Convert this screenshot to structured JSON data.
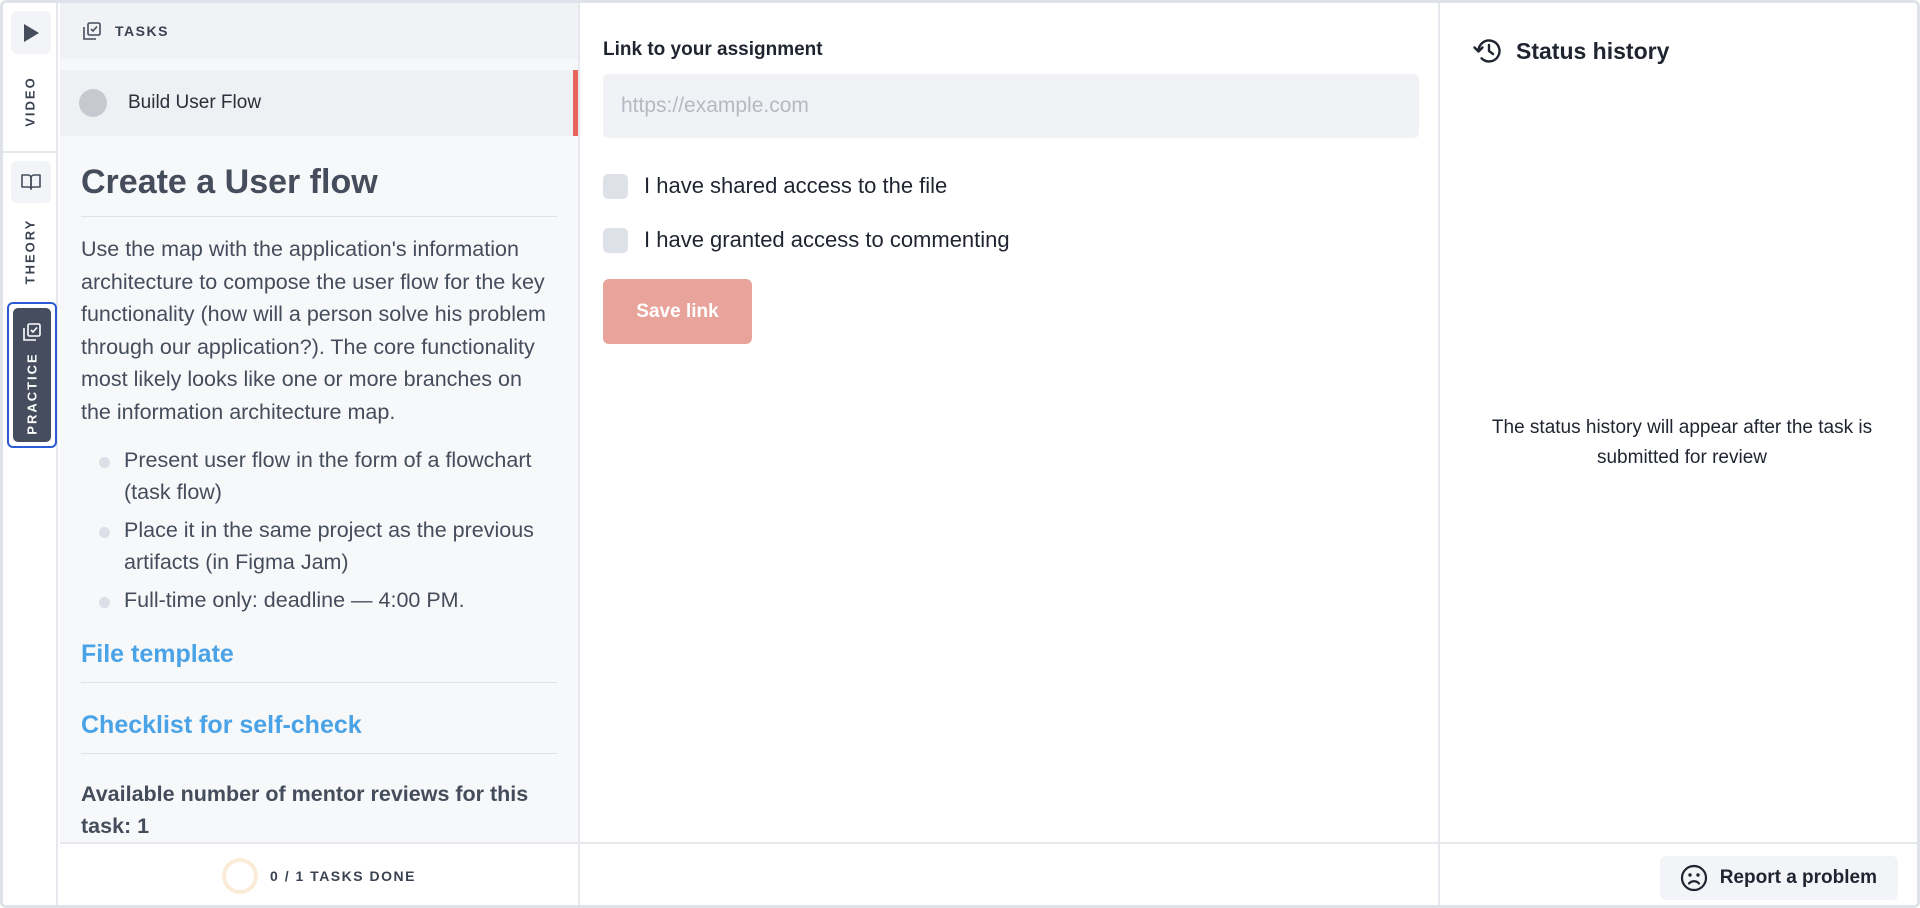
{
  "rail": {
    "video_label": "VIDEO",
    "theory_label": "THEORY",
    "practice_label": "PRACTICE"
  },
  "tasks": {
    "header_label": "TASKS",
    "items": [
      {
        "name": "Build User Flow"
      }
    ],
    "footer_count": "0 / 1 TASKS DONE",
    "progress": 0
  },
  "task_detail": {
    "title": "Create a User flow",
    "description": "Use the map with the application's information architecture to compose the user flow for the key functionality (how will a person solve his problem through our application?). The core functionality most likely looks like one or more branches on the information architecture map.",
    "bullets": [
      "Present user flow in the form of a flowchart (task flow)",
      "Place it in the same project as the previous artifacts (in Figma Jam)",
      "Full-time only: deadline — 4:00 PM."
    ],
    "file_template_label": "File template",
    "checklist_label": "Checklist for self-check",
    "available_reviews": "Available number of mentor reviews for this task: 1"
  },
  "assignment": {
    "field_label": "Link to your assignment",
    "input_value": "",
    "input_placeholder": "https://example.com",
    "checkbox_shared": "I have shared access to the file",
    "checkbox_commenting": "I have granted access to commenting",
    "save_label": "Save link"
  },
  "status_history": {
    "title": "Status history",
    "empty_text": "The status history will appear after the task is submitted for review"
  },
  "footer": {
    "report_label": "Report a problem"
  },
  "colors": {
    "accent_red": "#e8655b",
    "save_button_disabled": "#e8a39b",
    "link_blue": "#4aa3e6",
    "practice_active": "#454d5e",
    "focus_outline": "#2d5bd6"
  }
}
